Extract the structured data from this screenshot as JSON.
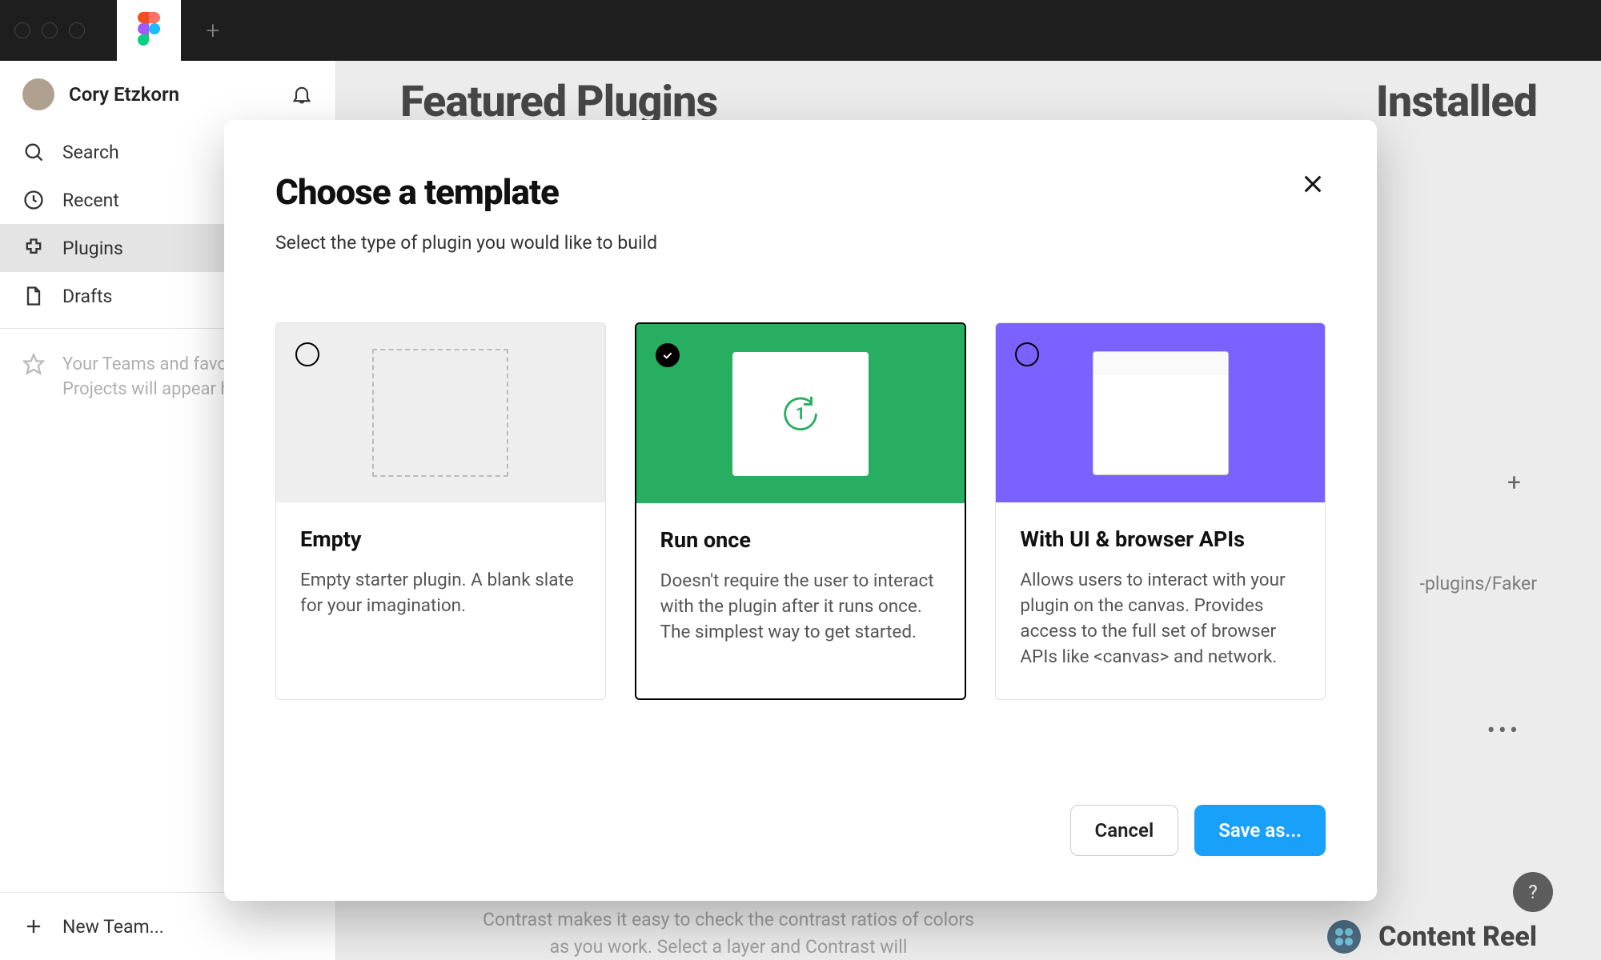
{
  "sidebar": {
    "user_name": "Cory Etzkorn",
    "nav": {
      "search": "Search",
      "recent": "Recent",
      "plugins": "Plugins",
      "drafts": "Drafts"
    },
    "teams_placeholder": "Your Teams and favorited Projects will appear here",
    "new_team": "New Team..."
  },
  "main": {
    "featured_heading": "Featured Plugins",
    "installed_heading": "Installed",
    "faker_path": "-plugins/Faker",
    "content_reel": "Content Reel",
    "contrast_desc": "Contrast makes it easy to check the contrast ratios of colors as you work. Select a layer and Contrast will"
  },
  "modal": {
    "title": "Choose a template",
    "subtitle": "Select the type of plugin you would like to build",
    "cards": [
      {
        "title": "Empty",
        "desc": "Empty starter plugin. A blank slate for your imagination.",
        "selected": false
      },
      {
        "title": "Run once",
        "desc": "Doesn't require the user to interact with the plugin after it runs once. The simplest way to get started.",
        "selected": true
      },
      {
        "title": "With UI & browser APIs",
        "desc": "Allows users to interact with your plugin on the canvas. Provides access to the full set of browser APIs like <canvas> and network.",
        "selected": false
      }
    ],
    "cancel": "Cancel",
    "save": "Save as..."
  },
  "help_label": "?"
}
